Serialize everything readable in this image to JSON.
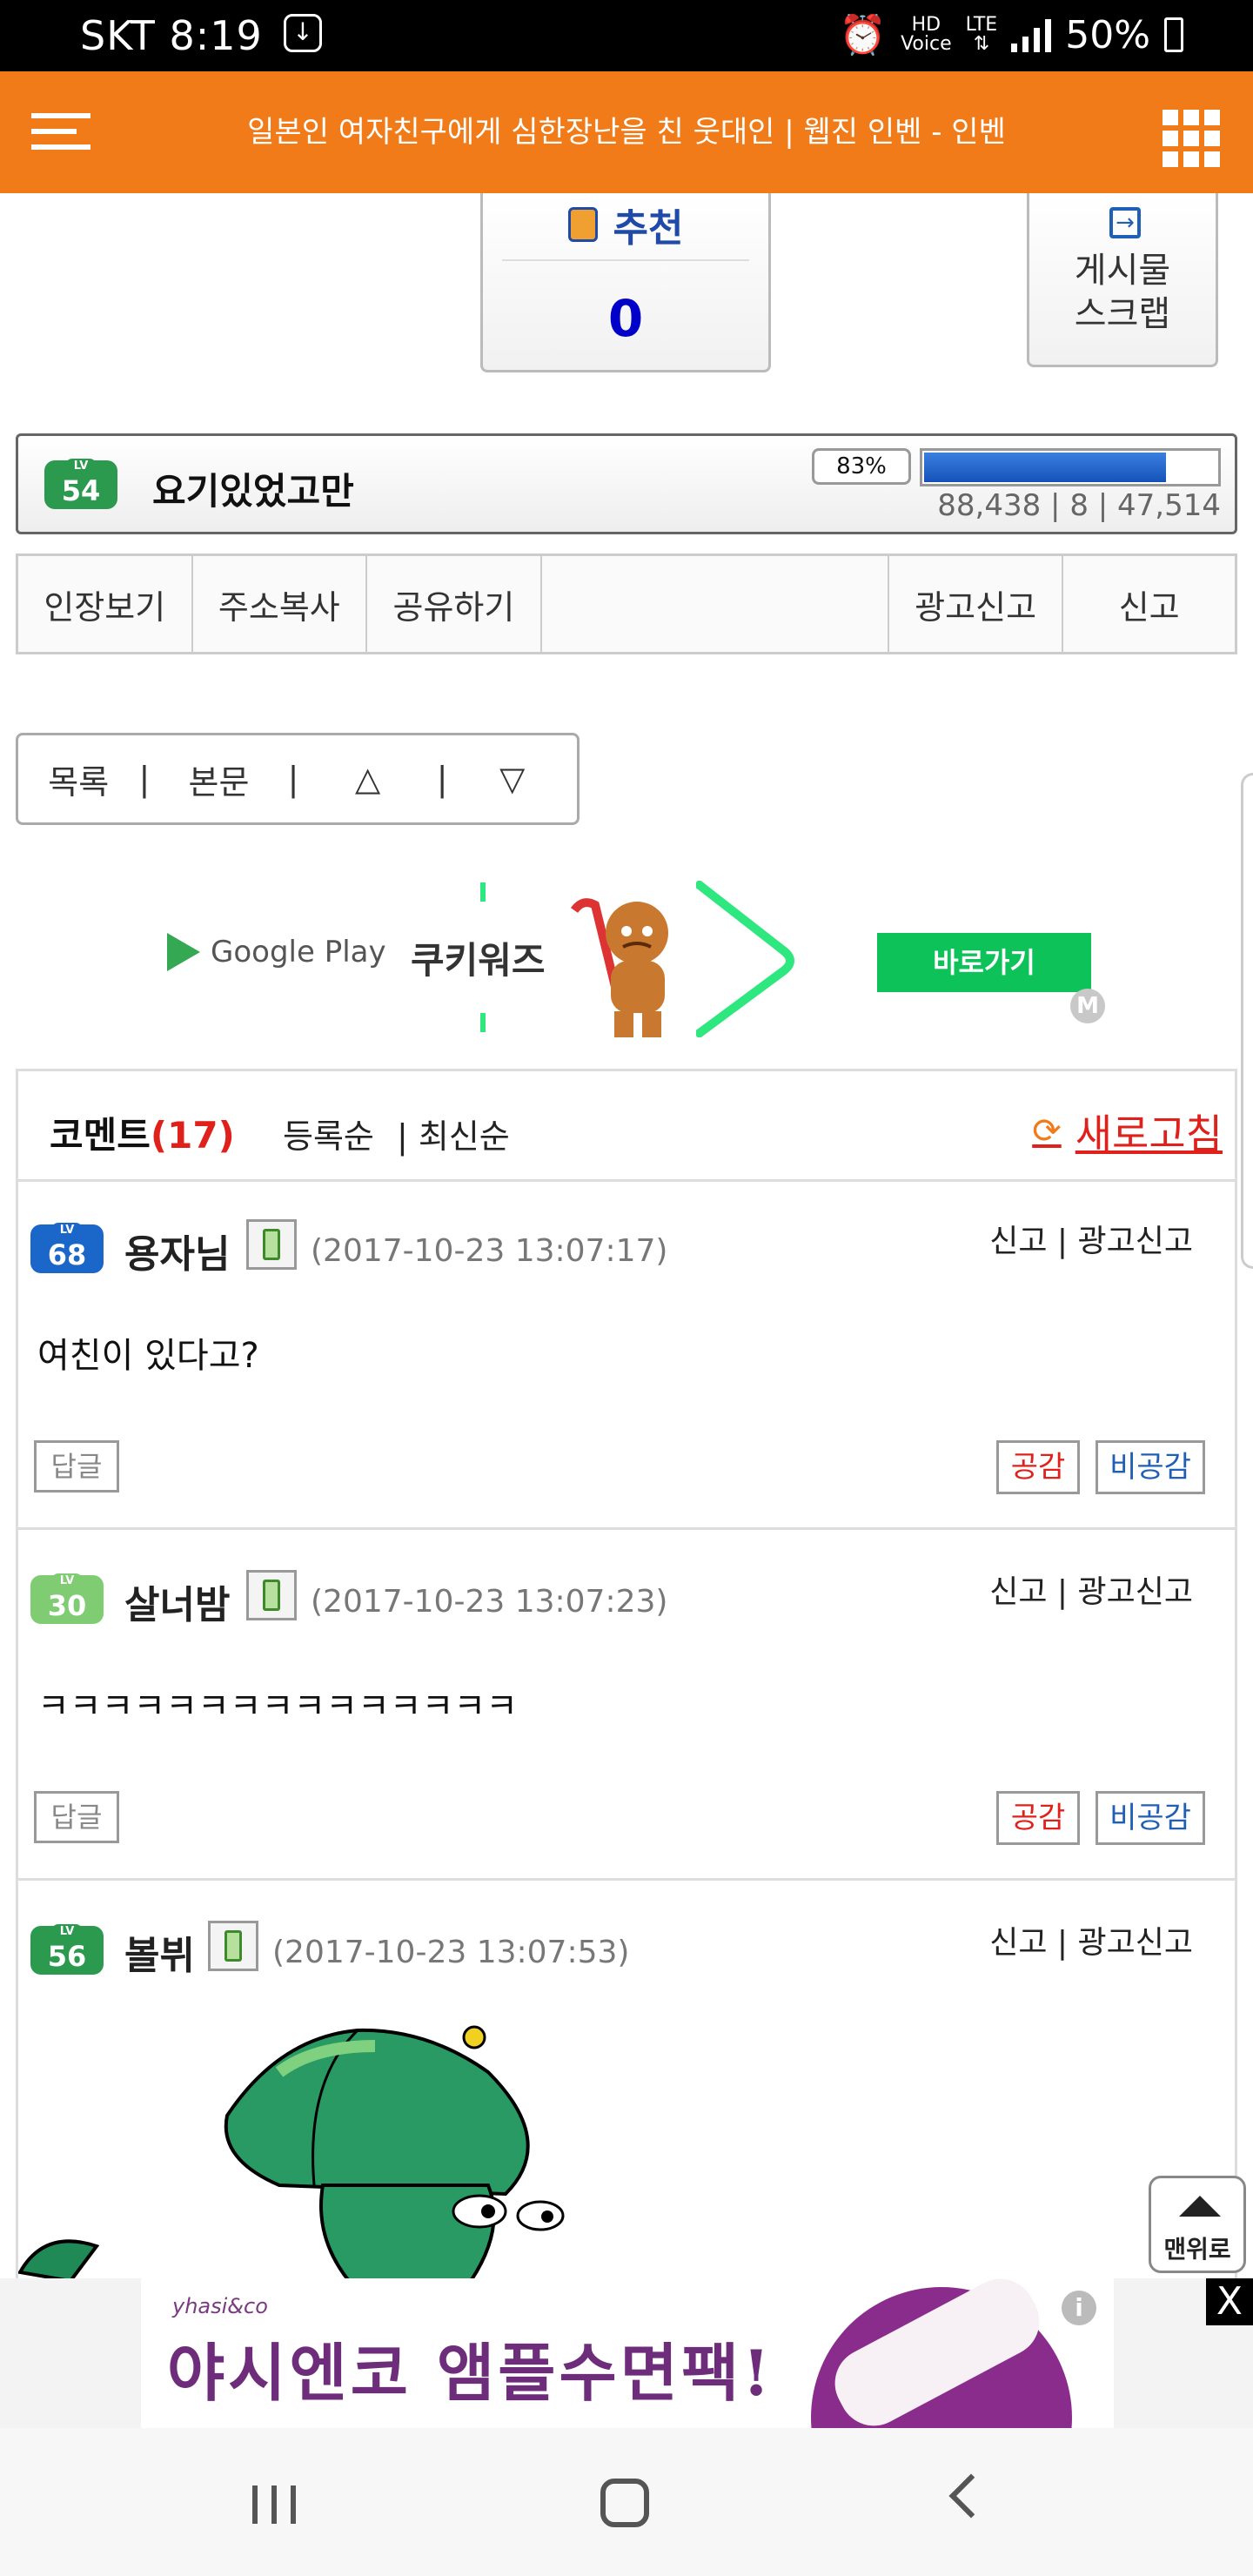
{
  "status_bar": {
    "carrier_time": "SKT 8:19",
    "hd_label": "HD",
    "voice_label": "Voice",
    "lte_label": "LTE",
    "battery": "50%"
  },
  "header": {
    "title": "일본인 여자친구에게 심한장난을 친 웃대인 | 웹진 인벤 - 인벤",
    "bg_color": "#f07b18"
  },
  "recommend": {
    "label": "추천",
    "count": "0"
  },
  "scrap": {
    "label": "게시물\n스크랩"
  },
  "author": {
    "level": "54",
    "level_tag": "LV",
    "name": "요기있었고만",
    "exp_percent_label": "83%",
    "exp_fraction": 0.83,
    "stats": "88,438 | 8 | 47,514"
  },
  "actions": [
    "인장보기",
    "주소복사",
    "공유하기",
    "광고신고",
    "신고"
  ],
  "nav": {
    "list": "목록",
    "body": "본문",
    "up": "△",
    "down": "▽",
    "sep": "|"
  },
  "ad_top": {
    "store": "Google Play",
    "game": "쿠키워즈",
    "cta": "바로가기",
    "badge": "M"
  },
  "comments_header": {
    "title": "코멘트",
    "count": "(17)",
    "sort_register": "등록순",
    "sort_sep": "|",
    "sort_latest": "최신순",
    "refresh": "새로고침"
  },
  "comments": [
    {
      "level": "68",
      "level_color": "#1a66c9",
      "nick": "용자님",
      "time": "(2017-10-23 13:07:17)",
      "report": "신고 | 광고신고",
      "body": "여친이 있다고?",
      "reply": "답글",
      "agree": "공감",
      "disagree": "비공감"
    },
    {
      "level": "30",
      "level_color": "#7fcc73",
      "nick": "살너밤",
      "time": "(2017-10-23 13:07:23)",
      "report": "신고 | 광고신고",
      "body": "ㅋㅋㅋㅋㅋㅋㅋㅋㅋㅋㅋㅋㅋㅋㅋ",
      "reply": "답글",
      "agree": "공감",
      "disagree": "비공감"
    },
    {
      "level": "56",
      "level_color": "#2b9a4e",
      "nick": "볼뷔",
      "time": "(2017-10-23 13:07:53)",
      "report": "신고 | 광고신고",
      "body": ""
    }
  ],
  "top_button": {
    "label": "맨위로"
  },
  "ad_bottom": {
    "brand": "yhasi&co",
    "text": "야시엔코 앰플수면팩!",
    "info": "i",
    "close": "X"
  },
  "icons": [
    "menu-icon",
    "grid-icon",
    "thumbs-up-icon",
    "scrap-icon",
    "refresh-icon",
    "phone-icon",
    "recent-apps-icon",
    "home-icon",
    "back-icon"
  ]
}
